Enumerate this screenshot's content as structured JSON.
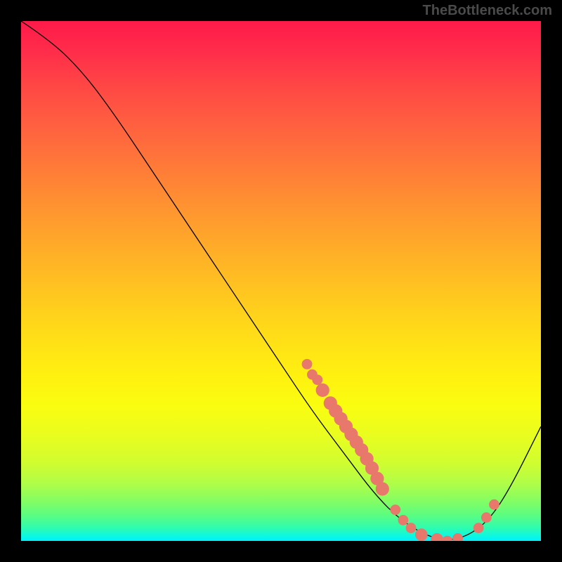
{
  "watermark": "TheBottleneck.com",
  "chart_data": {
    "type": "line",
    "title": "",
    "xlabel": "",
    "ylabel": "",
    "xlim": [
      0,
      100
    ],
    "ylim": [
      0,
      100
    ],
    "curve": [
      {
        "x": 0,
        "y": 100
      },
      {
        "x": 6,
        "y": 96
      },
      {
        "x": 12,
        "y": 90
      },
      {
        "x": 18,
        "y": 82
      },
      {
        "x": 26,
        "y": 70
      },
      {
        "x": 34,
        "y": 58
      },
      {
        "x": 42,
        "y": 46
      },
      {
        "x": 50,
        "y": 34
      },
      {
        "x": 56,
        "y": 25
      },
      {
        "x": 62,
        "y": 17
      },
      {
        "x": 68,
        "y": 9
      },
      {
        "x": 73,
        "y": 4
      },
      {
        "x": 78,
        "y": 1
      },
      {
        "x": 82,
        "y": 0
      },
      {
        "x": 86,
        "y": 1
      },
      {
        "x": 90,
        "y": 4
      },
      {
        "x": 94,
        "y": 10
      },
      {
        "x": 100,
        "y": 22
      }
    ],
    "markers": [
      {
        "x": 55,
        "y": 34,
        "r": 1.0
      },
      {
        "x": 56,
        "y": 32,
        "r": 1.0
      },
      {
        "x": 57,
        "y": 31,
        "r": 1.0
      },
      {
        "x": 58,
        "y": 29.0,
        "r": 1.3
      },
      {
        "x": 59.5,
        "y": 26.5,
        "r": 1.3
      },
      {
        "x": 60.5,
        "y": 25.0,
        "r": 1.3
      },
      {
        "x": 61.5,
        "y": 23.5,
        "r": 1.3
      },
      {
        "x": 62.5,
        "y": 22.0,
        "r": 1.3
      },
      {
        "x": 63.5,
        "y": 20.5,
        "r": 1.3
      },
      {
        "x": 64.5,
        "y": 19.0,
        "r": 1.3
      },
      {
        "x": 65.5,
        "y": 17.5,
        "r": 1.3
      },
      {
        "x": 66.5,
        "y": 15.8,
        "r": 1.3
      },
      {
        "x": 67.5,
        "y": 14.0,
        "r": 1.3
      },
      {
        "x": 68.5,
        "y": 12.0,
        "r": 1.3
      },
      {
        "x": 69.5,
        "y": 10.0,
        "r": 1.3
      },
      {
        "x": 72,
        "y": 6.0,
        "r": 1.0
      },
      {
        "x": 73.5,
        "y": 4.0,
        "r": 1.0
      },
      {
        "x": 75,
        "y": 2.5,
        "r": 1.0
      },
      {
        "x": 77,
        "y": 1.2,
        "r": 1.2
      },
      {
        "x": 80,
        "y": 0.3,
        "r": 1.2
      },
      {
        "x": 82,
        "y": 0.0,
        "r": 1.0
      },
      {
        "x": 84,
        "y": 0.5,
        "r": 1.0
      },
      {
        "x": 88,
        "y": 2.5,
        "r": 1.0
      },
      {
        "x": 89.5,
        "y": 4.5,
        "r": 1.0
      },
      {
        "x": 91,
        "y": 7.0,
        "r": 1.0
      }
    ],
    "colors": {
      "curve": "#000000",
      "marker": "#e8786b"
    }
  }
}
